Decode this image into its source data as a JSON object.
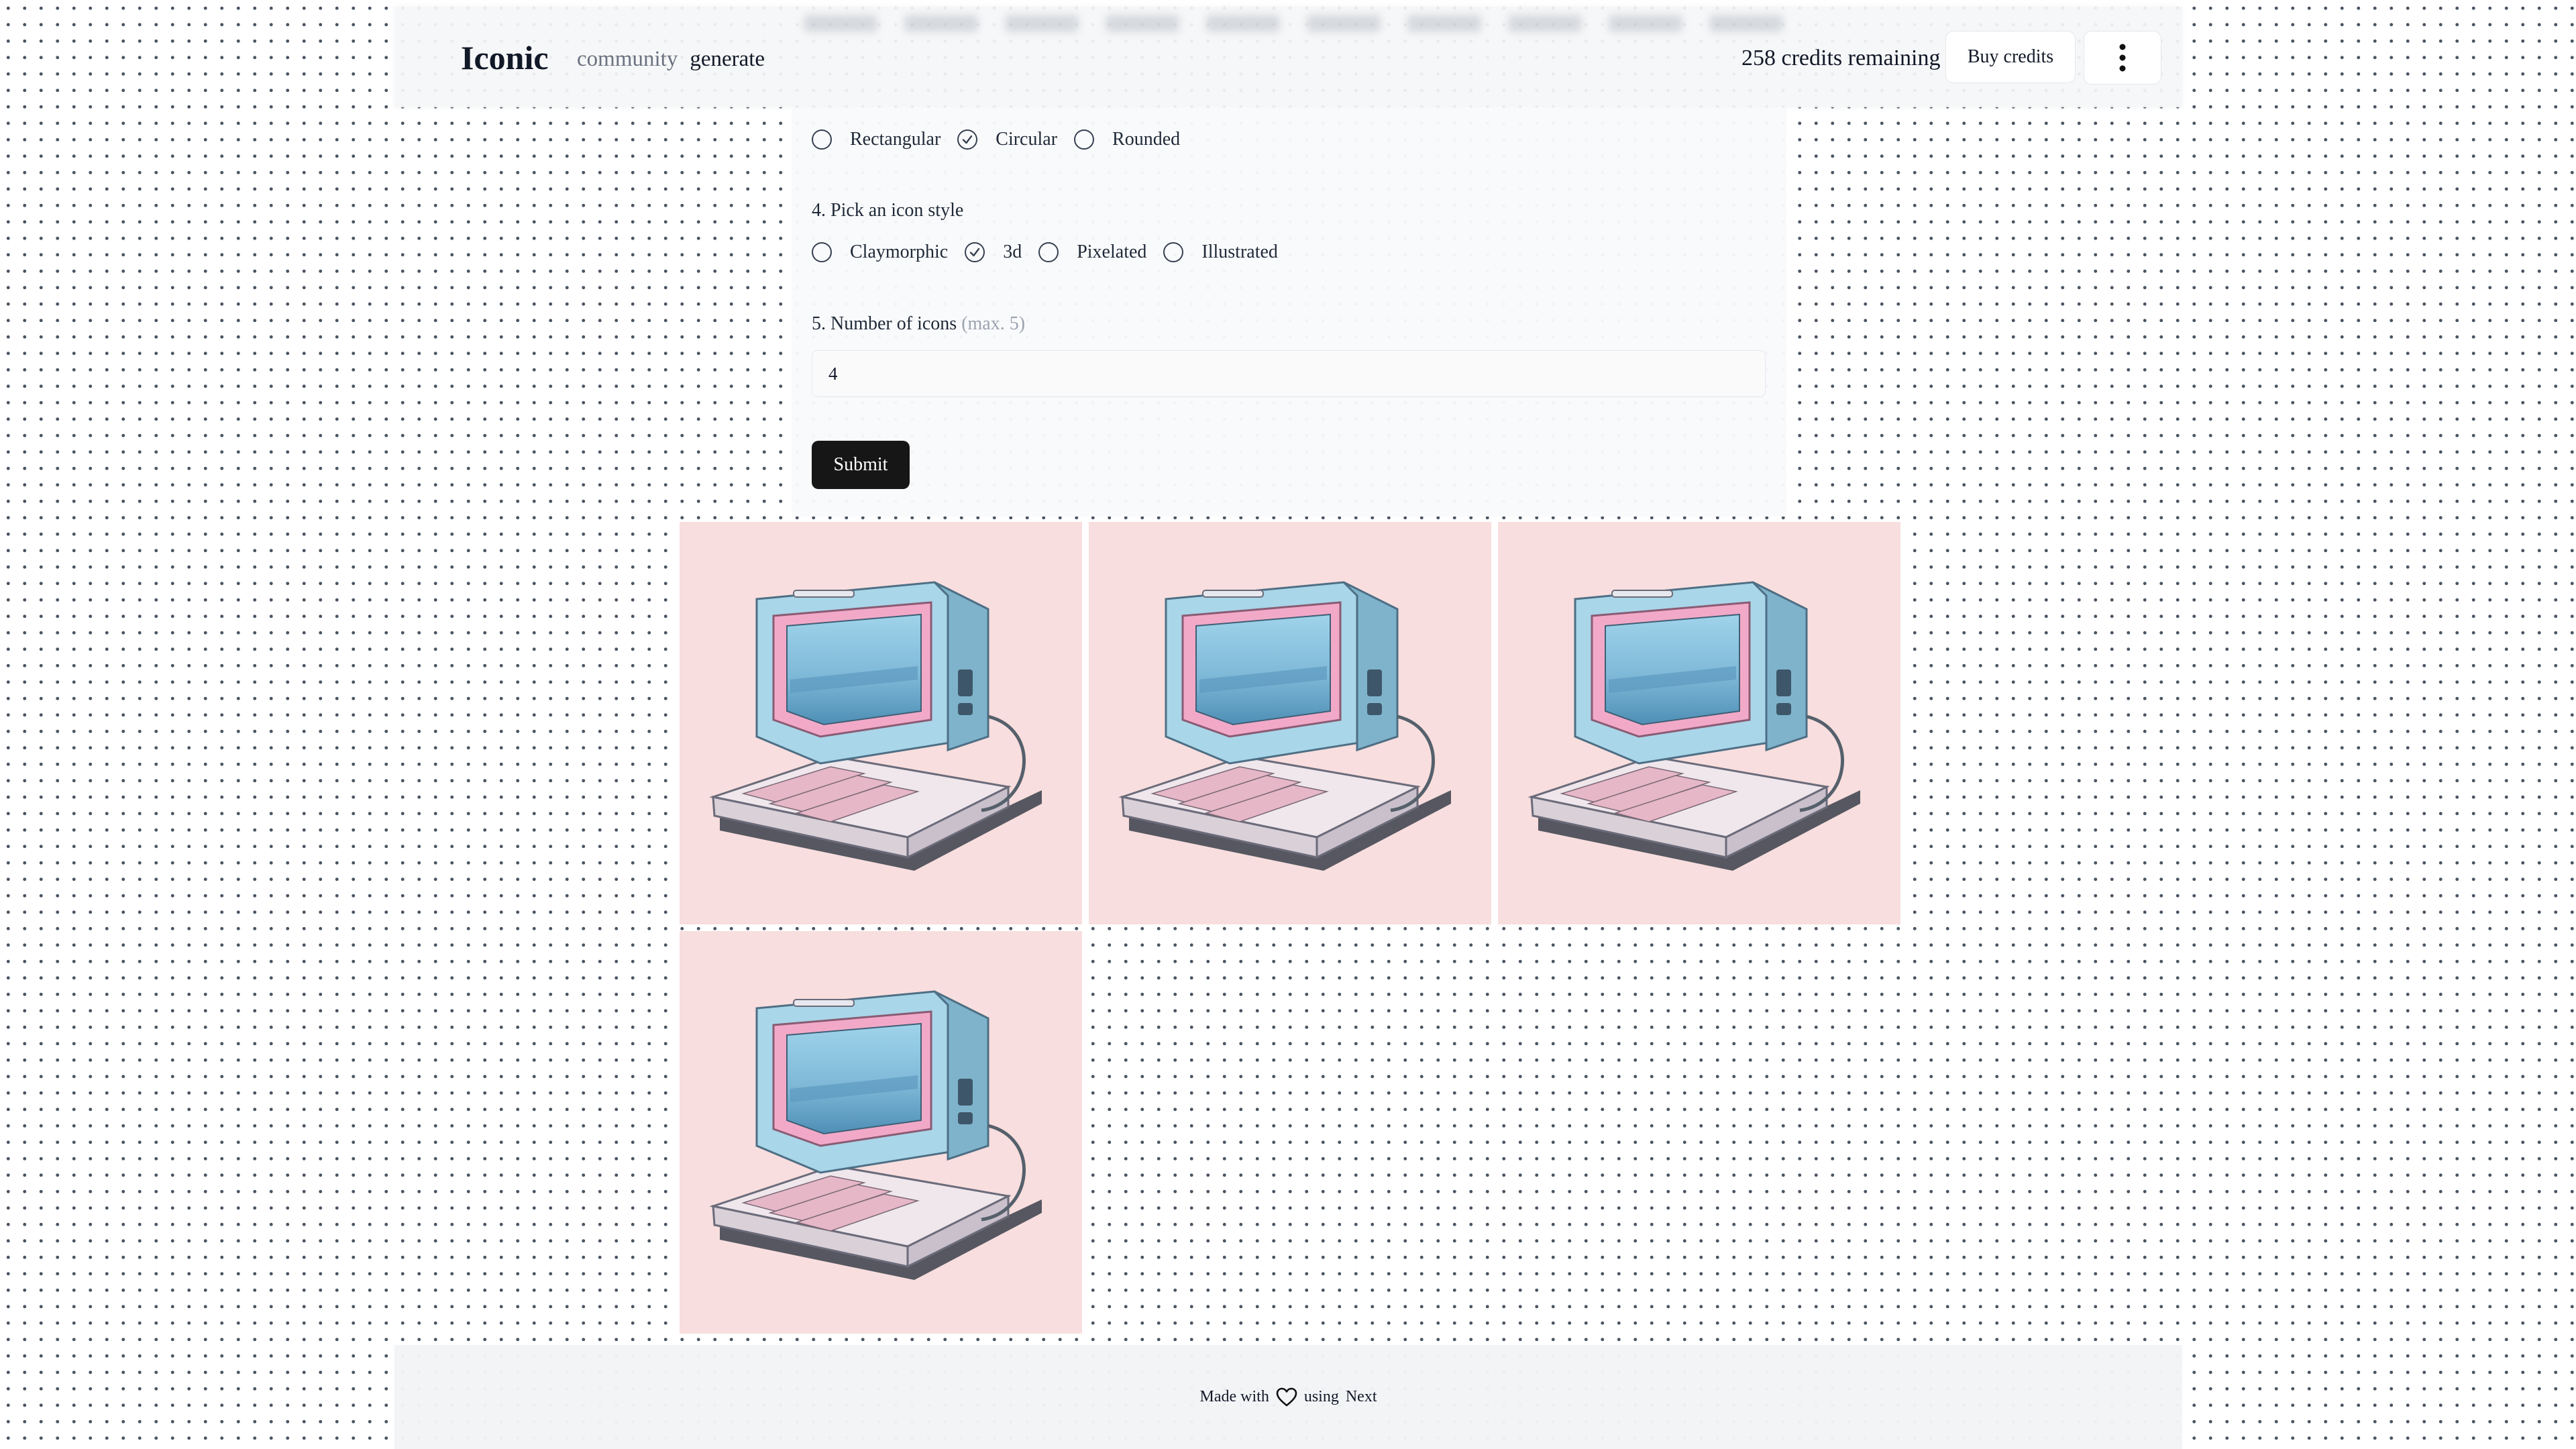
{
  "header": {
    "logo": "Iconic",
    "nav": {
      "community": "community",
      "generate": "generate"
    },
    "credits": "258 credits remaining",
    "buy_label": "Buy credits",
    "more_icon": "more-vertical-icon"
  },
  "form": {
    "shape_options": [
      {
        "label": "Rectangular",
        "selected": false
      },
      {
        "label": "Circular",
        "selected": true
      },
      {
        "label": "Rounded",
        "selected": false
      }
    ],
    "style_question": "4. Pick an icon style",
    "style_options": [
      {
        "label": "Claymorphic",
        "selected": false
      },
      {
        "label": "3d",
        "selected": true
      },
      {
        "label": "Pixelated",
        "selected": false
      },
      {
        "label": "Illustrated",
        "selected": false
      }
    ],
    "count_question": "5. Number of icons",
    "count_hint": "(max. 5)",
    "count_value": "4",
    "submit_label": "Submit"
  },
  "results": {
    "icons": [
      {
        "name": "retro-computer-icon"
      },
      {
        "name": "retro-computer-icon"
      },
      {
        "name": "retro-computer-icon"
      },
      {
        "name": "retro-computer-icon"
      }
    ],
    "colors": {
      "tile_bg": "#f8dede",
      "screen": "#8ecbe3",
      "bezel": "#f2a9c8",
      "body": "#a9d6e8"
    }
  },
  "footer": {
    "made_with": "Made with",
    "using": "using",
    "framework": "Next",
    "heart_icon": "heart-icon"
  }
}
